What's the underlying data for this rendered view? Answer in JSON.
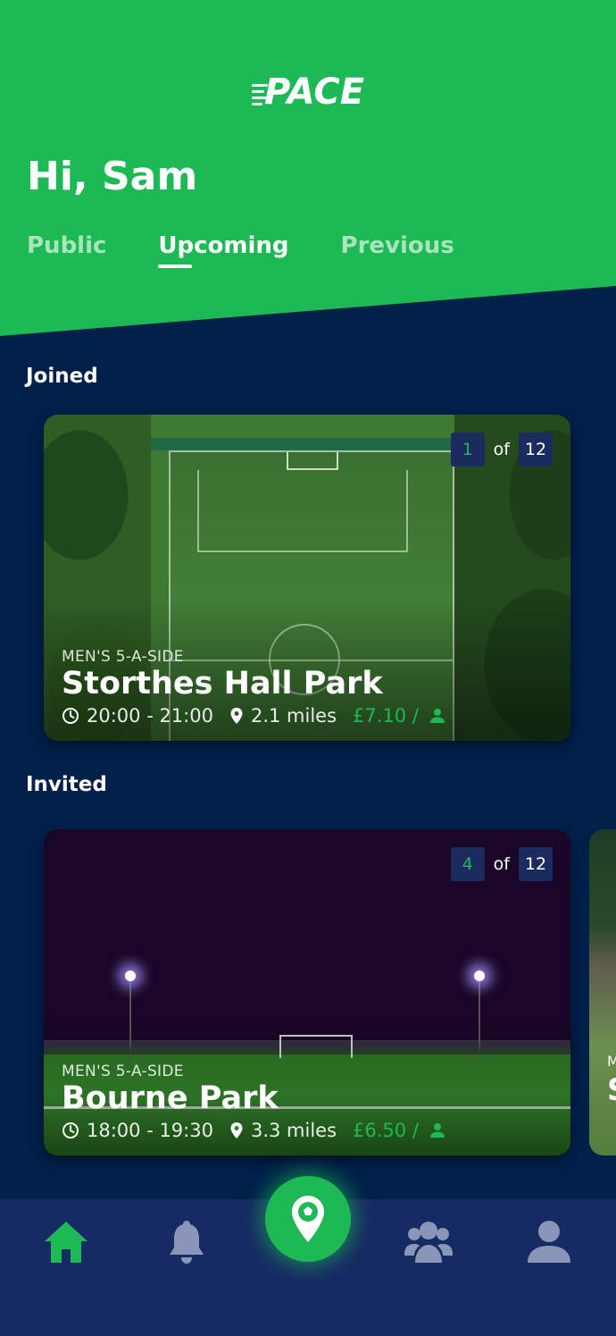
{
  "app": {
    "logo": "PACE"
  },
  "header": {
    "greeting": "Hi, Sam"
  },
  "tabs": [
    {
      "label": "Public",
      "active": false
    },
    {
      "label": "Upcoming",
      "active": true
    },
    {
      "label": "Previous",
      "active": false
    }
  ],
  "sections": {
    "joined": {
      "title": "Joined",
      "cards": [
        {
          "kind": "MEN'S 5-A-SIDE",
          "name": "Storthes Hall Park",
          "time": "20:00 - 21:00",
          "distance": "2.1 miles",
          "price": "£7.10 /",
          "spots_filled": "1",
          "of_label": "of",
          "spots_total": "12"
        }
      ]
    },
    "invited": {
      "title": "Invited",
      "cards": [
        {
          "kind": "MEN'S 5-A-SIDE",
          "name": "Bourne Park",
          "time": "18:00 - 19:30",
          "distance": "3.3 miles",
          "price": "£6.50 /",
          "spots_filled": "4",
          "of_label": "of",
          "spots_total": "12"
        }
      ],
      "peek": {
        "kind_initial": "M",
        "name_initial": "S"
      }
    }
  },
  "nav": {
    "items": [
      {
        "icon": "home-icon",
        "active": true
      },
      {
        "icon": "bell-icon",
        "active": false
      },
      {
        "icon": "map-pin-ball-icon",
        "active": false
      },
      {
        "icon": "group-icon",
        "active": false
      },
      {
        "icon": "person-icon",
        "active": false
      }
    ]
  },
  "colors": {
    "brand_green": "#1db954",
    "background_navy": "#00204a",
    "nav_bar": "#162a63",
    "badge_bg": "#1c2b5e",
    "inactive_icon": "#8a95b8"
  }
}
